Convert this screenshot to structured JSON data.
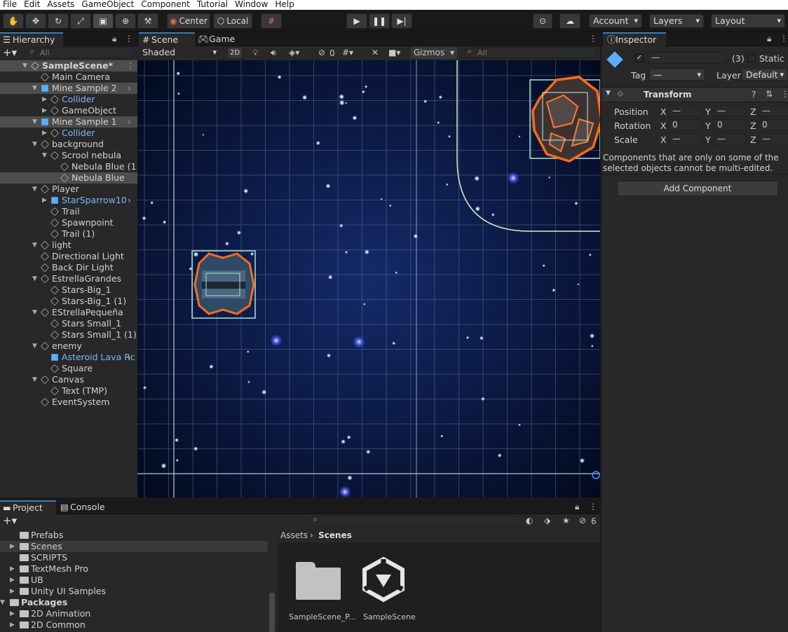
{
  "menu": [
    "File",
    "Edit",
    "Assets",
    "GameObject",
    "Component",
    "Tutorial",
    "Window",
    "Help"
  ],
  "toolbar": {
    "center": "Center",
    "local": "Local",
    "account": "Account",
    "layers": "Layers",
    "layout": "Layout"
  },
  "hierarchy": {
    "tab": "Hierarchy",
    "search_placeholder": "All",
    "items": [
      {
        "label": "SampleScene*",
        "arrow": "▼",
        "icon": "scene",
        "blue": false,
        "sel": true,
        "depth": 0
      },
      {
        "label": "Main Camera",
        "arrow": "",
        "icon": "cube",
        "blue": false,
        "sel": false,
        "depth": 1
      },
      {
        "label": "Mine Sample 2",
        "arrow": "▼",
        "icon": "prefab",
        "blue": false,
        "sel": true,
        "depth": 1
      },
      {
        "label": "Collider",
        "arrow": "▶",
        "icon": "cube",
        "blue": true,
        "sel": false,
        "depth": 2
      },
      {
        "label": "GameObject",
        "arrow": "▶",
        "icon": "cube",
        "blue": false,
        "sel": false,
        "depth": 2
      },
      {
        "label": "Mine Sample 1",
        "arrow": "▼",
        "icon": "prefab",
        "blue": false,
        "sel": true,
        "depth": 1
      },
      {
        "label": "Collider",
        "arrow": "▶",
        "icon": "cube",
        "blue": true,
        "sel": false,
        "depth": 2
      },
      {
        "label": "background",
        "arrow": "▼",
        "icon": "cube",
        "blue": false,
        "sel": false,
        "depth": 1
      },
      {
        "label": "Scrool nebula",
        "arrow": "▼",
        "icon": "cube",
        "blue": false,
        "sel": false,
        "depth": 2
      },
      {
        "label": "Nebula Blue (1)",
        "arrow": "",
        "icon": "cube",
        "blue": false,
        "sel": false,
        "depth": 3
      },
      {
        "label": "Nebula Blue",
        "arrow": "",
        "icon": "cube",
        "blue": false,
        "sel": true,
        "depth": 3
      },
      {
        "label": "Player",
        "arrow": "▼",
        "icon": "cube",
        "blue": false,
        "sel": false,
        "depth": 1
      },
      {
        "label": "StarSparrow10",
        "arrow": "▶",
        "icon": "prefab",
        "blue": true,
        "sel": false,
        "depth": 2
      },
      {
        "label": "Trail",
        "arrow": "",
        "icon": "cube",
        "blue": false,
        "sel": false,
        "depth": 2
      },
      {
        "label": "Spawnpoint",
        "arrow": "",
        "icon": "cube",
        "blue": false,
        "sel": false,
        "depth": 2
      },
      {
        "label": "Trail (1)",
        "arrow": "",
        "icon": "cube",
        "blue": false,
        "sel": false,
        "depth": 2
      },
      {
        "label": "light",
        "arrow": "▼",
        "icon": "cube",
        "blue": false,
        "sel": false,
        "depth": 1
      },
      {
        "label": "Directional Light",
        "arrow": "",
        "icon": "cube",
        "blue": false,
        "sel": false,
        "depth": 1
      },
      {
        "label": "Back Dir Light",
        "arrow": "",
        "icon": "cube",
        "blue": false,
        "sel": false,
        "depth": 1
      },
      {
        "label": "EstrellaGrandes",
        "arrow": "▼",
        "icon": "cube",
        "blue": false,
        "sel": false,
        "depth": 1
      },
      {
        "label": "Stars-Big_1",
        "arrow": "",
        "icon": "cube",
        "blue": false,
        "sel": false,
        "depth": 2
      },
      {
        "label": "Stars-Big_1 (1)",
        "arrow": "",
        "icon": "cube",
        "blue": false,
        "sel": false,
        "depth": 2
      },
      {
        "label": "EStrellaPequeña",
        "arrow": "▼",
        "icon": "cube",
        "blue": false,
        "sel": false,
        "depth": 1
      },
      {
        "label": "Stars Small_1",
        "arrow": "",
        "icon": "cube",
        "blue": false,
        "sel": false,
        "depth": 2
      },
      {
        "label": "Stars Small_1 (1)",
        "arrow": "",
        "icon": "cube",
        "blue": false,
        "sel": false,
        "depth": 2
      },
      {
        "label": "enemy",
        "arrow": "▼",
        "icon": "cube",
        "blue": false,
        "sel": false,
        "depth": 1
      },
      {
        "label": "Asteroid Lava Rc",
        "arrow": "",
        "icon": "prefab",
        "blue": true,
        "sel": false,
        "depth": 2
      },
      {
        "label": "Square",
        "arrow": "",
        "icon": "cube",
        "blue": false,
        "sel": false,
        "depth": 2
      },
      {
        "label": "Canvas",
        "arrow": "▼",
        "icon": "cube",
        "blue": false,
        "sel": false,
        "depth": 1
      },
      {
        "label": "Text (TMP)",
        "arrow": "",
        "icon": "cube",
        "blue": false,
        "sel": false,
        "depth": 2
      },
      {
        "label": "EventSystem",
        "arrow": "",
        "icon": "cube",
        "blue": false,
        "sel": false,
        "depth": 1
      }
    ]
  },
  "scene": {
    "tab_scene": "Scene",
    "tab_game": "Game",
    "shading": "Shaded",
    "mode2d": "2D",
    "hidden_count": "0",
    "gizmos": "Gizmos",
    "search_placeholder": "All"
  },
  "inspector": {
    "tab": "Inspector",
    "name_value": "—",
    "count": "(3)",
    "static_label": "Static",
    "tag_label": "Tag",
    "tag_value": "—",
    "layer_label": "Layer",
    "layer_value": "Default",
    "transform": "Transform",
    "rows": [
      {
        "label": "Position",
        "x": "—",
        "y": "—",
        "z": "—"
      },
      {
        "label": "Rotation",
        "x": "0",
        "y": "0",
        "z": "0"
      },
      {
        "label": "Scale",
        "x": "—",
        "y": "—",
        "z": "—"
      }
    ],
    "axes": [
      "X",
      "Y",
      "Z"
    ],
    "note": "Components that are only on some of the selected objects cannot be multi-edited.",
    "add_component": "Add Component"
  },
  "project": {
    "tab_project": "Project",
    "tab_console": "Console",
    "hidden_count": "6",
    "breadcrumb_root": "Assets",
    "breadcrumb_current": "Scenes",
    "tree": [
      {
        "label": "Prefabs",
        "arrow": "",
        "depth": 1,
        "sel": false
      },
      {
        "label": "Scenes",
        "arrow": "▶",
        "depth": 1,
        "sel": true
      },
      {
        "label": "SCRIPTS",
        "arrow": "",
        "depth": 1,
        "sel": false
      },
      {
        "label": "TextMesh Pro",
        "arrow": "▶",
        "depth": 1,
        "sel": false
      },
      {
        "label": "UB",
        "arrow": "▶",
        "depth": 1,
        "sel": false
      },
      {
        "label": "Unity UI Samples",
        "arrow": "▶",
        "depth": 1,
        "sel": false
      },
      {
        "label": "Packages",
        "arrow": "▼",
        "depth": 0,
        "sel": false,
        "bold": true
      },
      {
        "label": "2D Animation",
        "arrow": "▶",
        "depth": 1,
        "sel": false
      },
      {
        "label": "2D Common",
        "arrow": "▶",
        "depth": 1,
        "sel": false
      }
    ],
    "assets": [
      {
        "label": "SampleScene_P...",
        "type": "folder"
      },
      {
        "label": "SampleScene",
        "type": "unity-scene"
      }
    ]
  }
}
